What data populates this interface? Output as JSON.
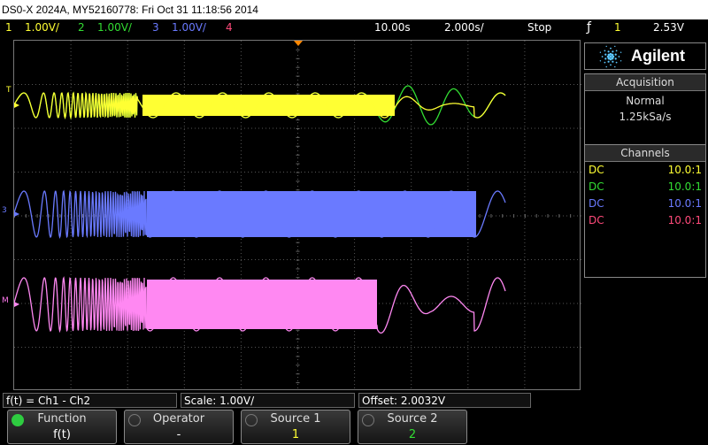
{
  "title_bar": {
    "text": "DS0-X 2024A, MY52160778: Fri Oct 31 11:18:56 2014"
  },
  "channels_header": [
    {
      "num": "1",
      "scale": "1.00V/",
      "color": "#ffff33"
    },
    {
      "num": "2",
      "scale": "1.00V/",
      "color": "#33dd33"
    },
    {
      "num": "3",
      "scale": "1.00V/",
      "color": "#6a7aff"
    },
    {
      "num": "4",
      "scale": "",
      "color": "#ff4a7a"
    }
  ],
  "timebase": {
    "delay": "10.00s",
    "scale": "2.000s/",
    "run_state": "Stop"
  },
  "trigger": {
    "slope_glyph": "ƒ",
    "source": "1",
    "level": "2.53V"
  },
  "brand": {
    "name": "Agilent"
  },
  "acquisition": {
    "heading": "Acquisition",
    "mode": "Normal",
    "rate": "1.25kSa/s"
  },
  "channels_panel": {
    "heading": "Channels",
    "rows": [
      {
        "coupling": "DC",
        "probe": "10.0:1",
        "color": "#ffff33"
      },
      {
        "coupling": "DC",
        "probe": "10.0:1",
        "color": "#33dd33"
      },
      {
        "coupling": "DC",
        "probe": "10.0:1",
        "color": "#6a7aff"
      },
      {
        "coupling": "DC",
        "probe": "10.0:1",
        "color": "#ff4a7a"
      }
    ]
  },
  "math": {
    "function_text": "f(t) = Ch1 - Ch2",
    "scale_text": "Scale: 1.00V/",
    "offset_text": "Offset: 2.0032V"
  },
  "softkeys": [
    {
      "label": "Function",
      "value": "f(t)",
      "value_color": "#ffffff"
    },
    {
      "label": "Operator",
      "value": "-",
      "value_color": "#ffffff"
    },
    {
      "label": "Source 1",
      "value": "1",
      "value_color": "#ffff33"
    },
    {
      "label": "Source 2",
      "value": "2",
      "value_color": "#33dd33"
    }
  ],
  "marker_labels": {
    "ch3": "3",
    "math": "M",
    "trig": "T"
  }
}
